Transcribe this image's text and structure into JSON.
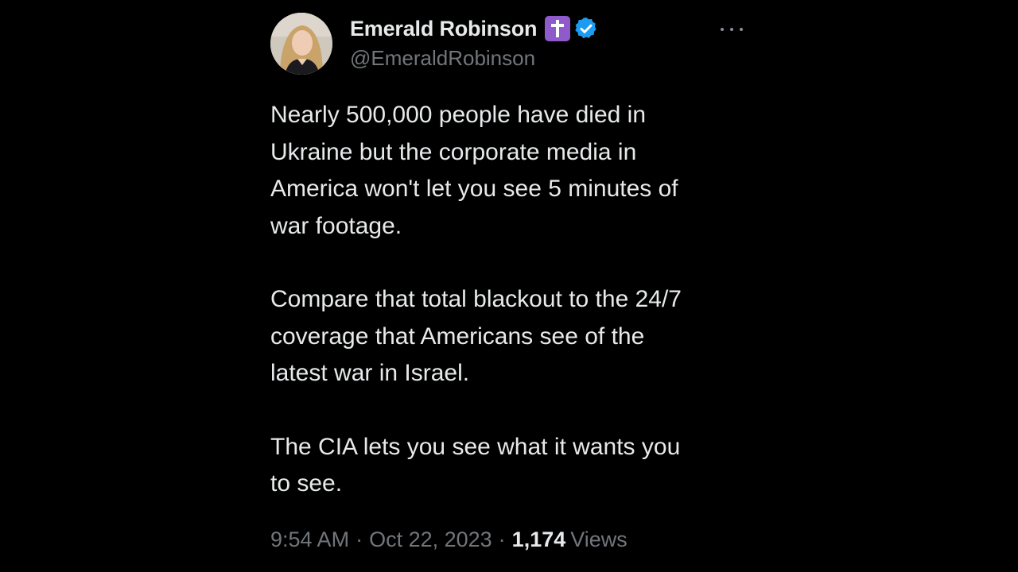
{
  "author": {
    "display_name": "Emerald Robinson",
    "handle": "@EmeraldRobinson",
    "badge_icon": "latin-cross-icon",
    "badge_color": "#8f5ac9",
    "verified_icon": "verified-badge-icon",
    "verified_color": "#1d9bf0"
  },
  "tweet": {
    "paragraphs": [
      {
        "lines": [
          "Nearly 500,000 people have died in",
          "Ukraine but the corporate media in",
          "America won't let you see 5 minutes of",
          "war footage."
        ]
      },
      {
        "lines": [
          "Compare that total blackout to the 24/7",
          "coverage that Americans see of the",
          "latest war in Israel."
        ]
      },
      {
        "lines": [
          "The CIA lets you see what it wants you",
          "to see."
        ]
      }
    ],
    "time": "9:54 AM",
    "date": "Oct 22, 2023",
    "separator": "·",
    "views_count": "1,174",
    "views_label": "Views"
  },
  "colors": {
    "background": "#000000",
    "text_primary": "#e7e9ea",
    "text_secondary": "#71767b"
  }
}
